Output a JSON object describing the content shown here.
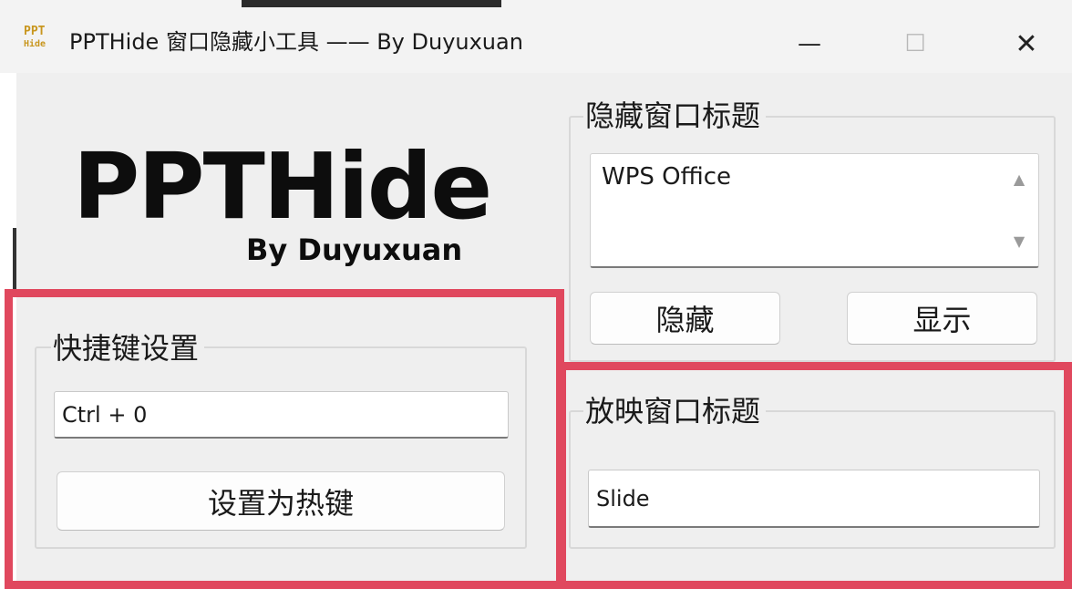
{
  "window": {
    "icon_text_top": "PPT",
    "icon_text_bottom": "Hide",
    "title": "PPTHide 窗口隐藏小工具 —— By Duyuxuan",
    "minimize_glyph": "—",
    "maximize_glyph": "☐",
    "close_glyph": "✕"
  },
  "logo": {
    "main": "PPTHide",
    "sub": "By Duyuxuan"
  },
  "hotkey": {
    "group_title": "快捷键设置",
    "value": "Ctrl + 0",
    "set_button": "设置为热键"
  },
  "hide_window": {
    "group_title": "隐藏窗口标题",
    "value": "WPS Office",
    "scroll_up": "▲",
    "scroll_down": "▼",
    "hide_button": "隐藏",
    "show_button": "显示"
  },
  "slideshow_window": {
    "group_title": "放映窗口标题",
    "value": "Slide"
  },
  "colors": {
    "highlight": "#e0485e",
    "background": "#efefef",
    "logo": "#0d0d0d",
    "icon": "#c8961e"
  }
}
